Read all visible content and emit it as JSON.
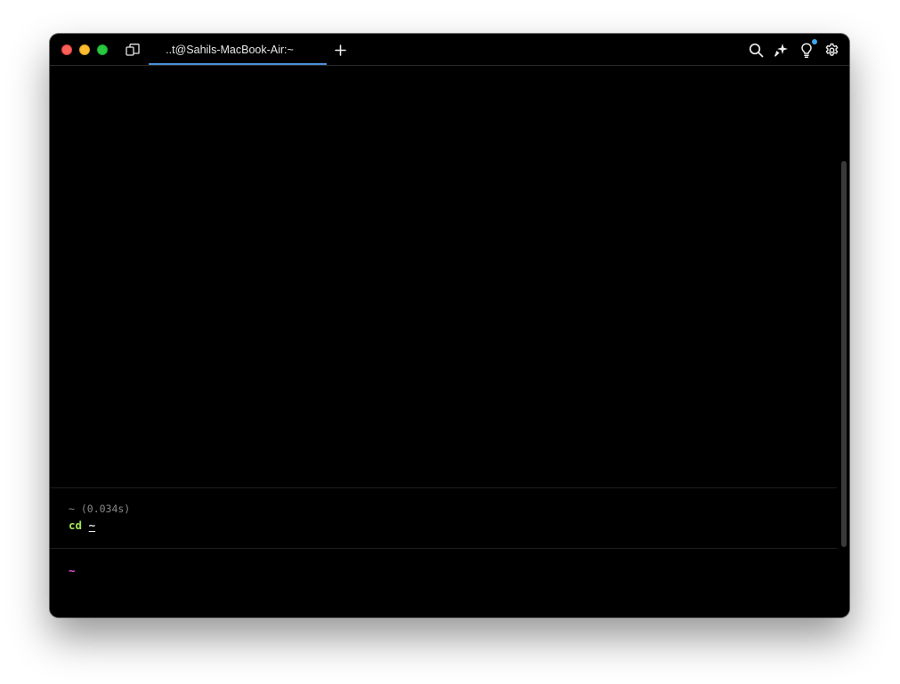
{
  "window": {
    "tab_title": "..t@Sahils-MacBook-Air:~"
  },
  "toolbar": {
    "left_icons": [
      "dual-panel-icon"
    ],
    "new_tab_icon": "plus-icon",
    "right_icons": [
      "search-icon",
      "ai-sparkle-icon",
      "lightbulb-icon",
      "gear-icon"
    ],
    "notification_color": "#3ea7f0"
  },
  "terminal": {
    "block": {
      "header": "~ (0.034s)",
      "command": "cd",
      "argument": "~"
    },
    "prompt": "~"
  },
  "colors": {
    "accent": "#4a90d9",
    "command": "#a3e05a",
    "prompt": "#e44fd3",
    "background": "#000000"
  }
}
